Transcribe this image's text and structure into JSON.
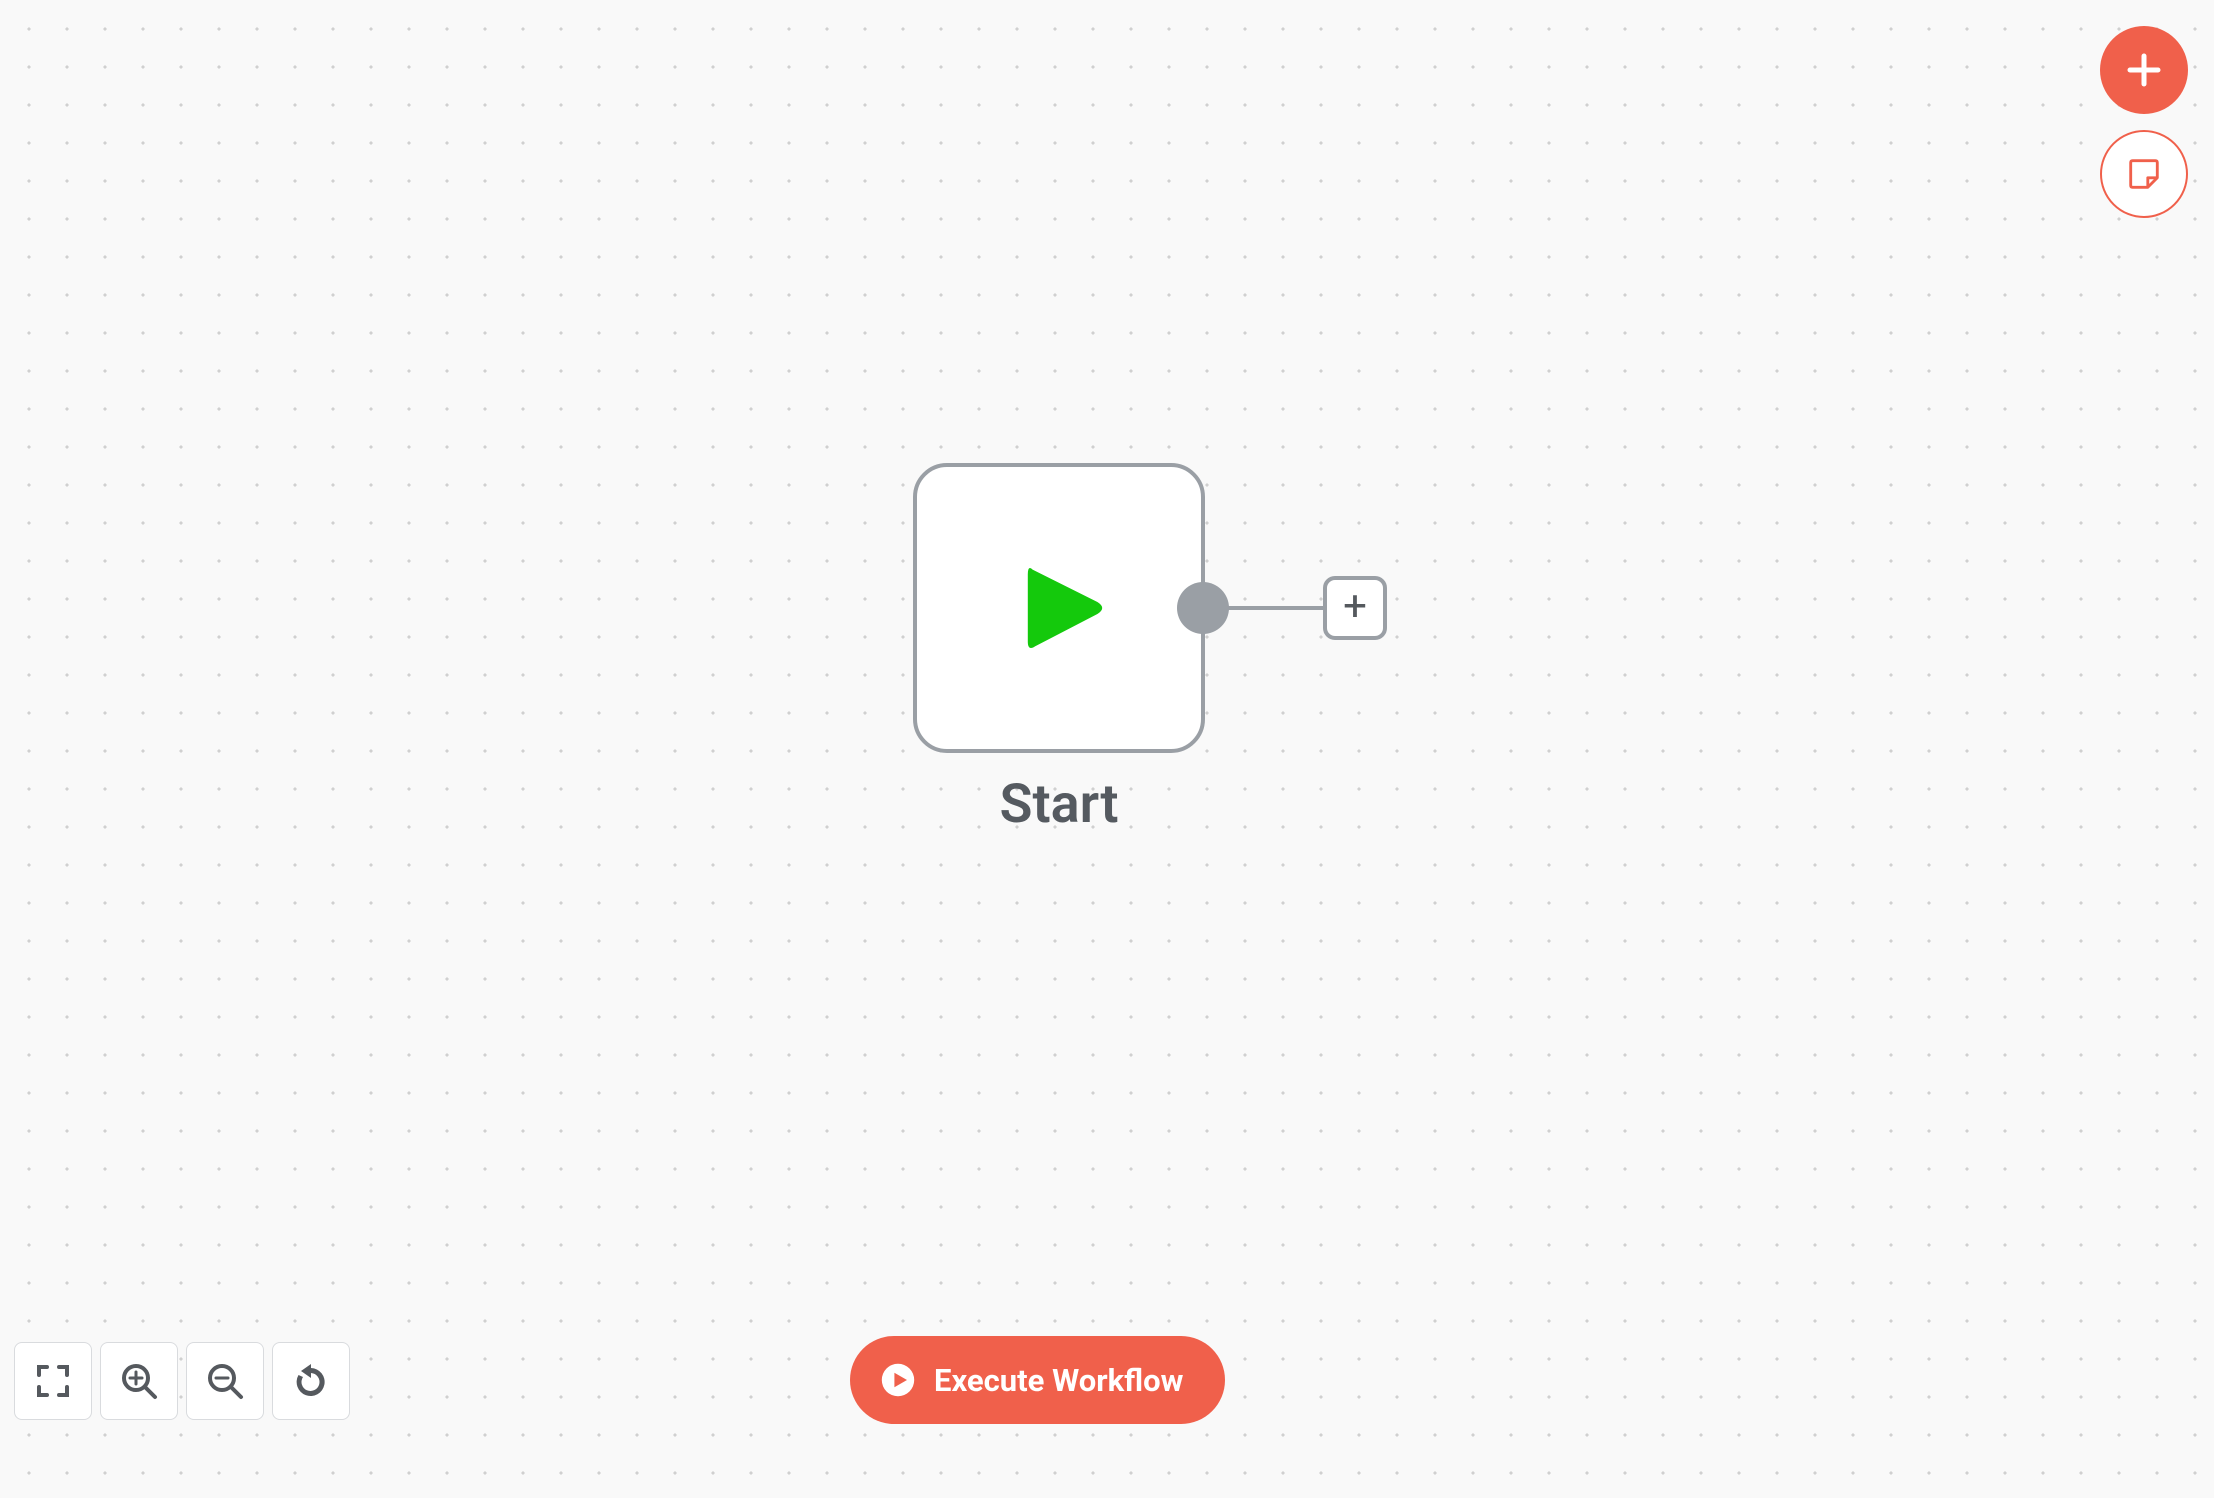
{
  "node": {
    "label": "Start"
  },
  "execute_button": {
    "label": "Execute Workflow"
  },
  "colors": {
    "accent": "#f0604b",
    "play_green": "#14c90c",
    "node_border": "#9a9fa5"
  }
}
